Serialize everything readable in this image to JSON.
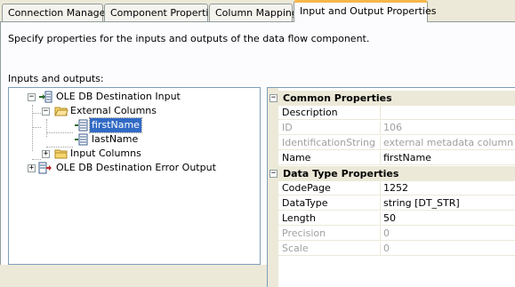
{
  "tabs": [
    {
      "label": "Connection Managers",
      "active": false
    },
    {
      "label": "Component Properties",
      "active": false
    },
    {
      "label": "Column Mappings",
      "active": false
    },
    {
      "label": "Input and Output Properties",
      "active": true
    }
  ],
  "description": "Specify properties for the inputs and outputs of the data flow component.",
  "io_label": "Inputs and outputs:",
  "tree": {
    "destination_input": {
      "label": "OLE DB Destination Input",
      "expander": "−"
    },
    "external_columns": {
      "label": "External Columns",
      "expander": "−"
    },
    "first_name": {
      "label": "firstName",
      "selected": true
    },
    "last_name": {
      "label": "lastName"
    },
    "input_columns": {
      "label": "Input Columns",
      "expander": "+"
    },
    "error_output": {
      "label": "OLE DB Destination Error Output",
      "expander": "+"
    }
  },
  "properties": {
    "common": {
      "title": "Common Properties",
      "expander": "−",
      "rows": [
        {
          "name": "Description",
          "value": "",
          "disabled": false
        },
        {
          "name": "ID",
          "value": "106",
          "disabled": true
        },
        {
          "name": "IdentificationString",
          "value": "external metadata column \"firs",
          "disabled": true
        },
        {
          "name": "Name",
          "value": "firstName",
          "disabled": false
        }
      ]
    },
    "data_type": {
      "title": "Data Type Properties",
      "expander": "−",
      "rows": [
        {
          "name": "CodePage",
          "value": "1252",
          "disabled": false
        },
        {
          "name": "DataType",
          "value": "string [DT_STR]",
          "disabled": false
        },
        {
          "name": "Length",
          "value": "50",
          "disabled": false
        },
        {
          "name": "Precision",
          "value": "0",
          "disabled": true
        },
        {
          "name": "Scale",
          "value": "0",
          "disabled": true
        }
      ]
    }
  },
  "colors": {
    "selection": "#316ac5",
    "tab_accent": "#f7b64b",
    "panel": "#ece9d8"
  }
}
